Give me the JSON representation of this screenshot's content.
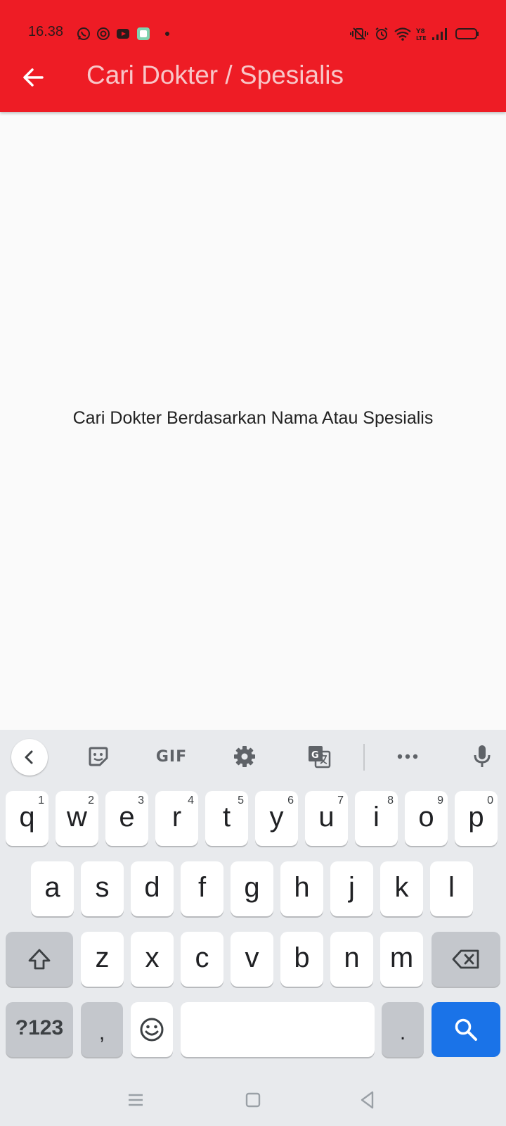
{
  "status_bar": {
    "time": "16.38",
    "notification_icons": [
      "whatsapp-icon",
      "threads-icon",
      "youtube-icon",
      "app-icon",
      "dot-icon"
    ],
    "system_icons": [
      "vibrate-icon",
      "alarm-icon",
      "wifi-icon",
      "volte-icon",
      "signal-icon",
      "battery-icon"
    ]
  },
  "app_bar": {
    "title": "Cari Dokter / Spesialis",
    "background": "#ee1c25",
    "title_color": "#f8c6c8"
  },
  "content": {
    "hint": "Cari Dokter Berdasarkan Nama Atau Spesialis"
  },
  "keyboard": {
    "toolbar": [
      "collapse-icon",
      "sticker-icon",
      "GIF",
      "settings-icon",
      "translate-icon",
      "more-icon",
      "mic-icon"
    ],
    "gif_label": "GIF",
    "row1": [
      {
        "k": "q",
        "n": "1"
      },
      {
        "k": "w",
        "n": "2"
      },
      {
        "k": "e",
        "n": "3"
      },
      {
        "k": "r",
        "n": "4"
      },
      {
        "k": "t",
        "n": "5"
      },
      {
        "k": "y",
        "n": "6"
      },
      {
        "k": "u",
        "n": "7"
      },
      {
        "k": "i",
        "n": "8"
      },
      {
        "k": "o",
        "n": "9"
      },
      {
        "k": "p",
        "n": "0"
      }
    ],
    "row2": [
      "a",
      "s",
      "d",
      "f",
      "g",
      "h",
      "j",
      "k",
      "l"
    ],
    "row3": [
      "z",
      "x",
      "c",
      "v",
      "b",
      "n",
      "m"
    ],
    "symbols_label": "?123",
    "comma_label": ",",
    "period_label": ".",
    "enter_color": "#1a73e8"
  }
}
